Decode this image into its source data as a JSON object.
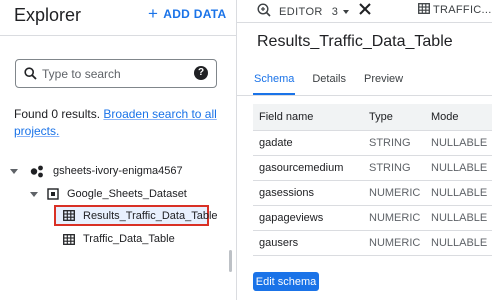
{
  "explorer": {
    "title": "Explorer",
    "add_data_label": "ADD DATA",
    "search_placeholder": "Type to search",
    "results_prefix": "Found 0 results.",
    "results_link": "Broaden search to all projects.",
    "project_name": "gsheets-ivory-enigma4567",
    "dataset_name": "Google_Sheets_Dataset",
    "tables": [
      "Results_Traffic_Data_Table",
      "Traffic_Data_Table"
    ]
  },
  "editor_bar": {
    "editor_label": "EDITOR",
    "editor_count": "3",
    "table_tab_label": "TRAFFIC..."
  },
  "details": {
    "title": "Results_Traffic_Data_Table",
    "tabs": [
      "Schema",
      "Details",
      "Preview"
    ],
    "active_tab": "Schema",
    "columns": [
      "Field name",
      "Type",
      "Mode"
    ],
    "fields": [
      {
        "name": "gadate",
        "type": "STRING",
        "mode": "NULLABLE"
      },
      {
        "name": "gasourcemedium",
        "type": "STRING",
        "mode": "NULLABLE"
      },
      {
        "name": "gasessions",
        "type": "NUMERIC",
        "mode": "NULLABLE"
      },
      {
        "name": "gapageviews",
        "type": "NUMERIC",
        "mode": "NULLABLE"
      },
      {
        "name": "gausers",
        "type": "NUMERIC",
        "mode": "NULLABLE"
      }
    ],
    "edit_schema_label": "Edit schema"
  },
  "colors": {
    "accent": "#1a73e8",
    "highlight_border": "#d93025"
  }
}
